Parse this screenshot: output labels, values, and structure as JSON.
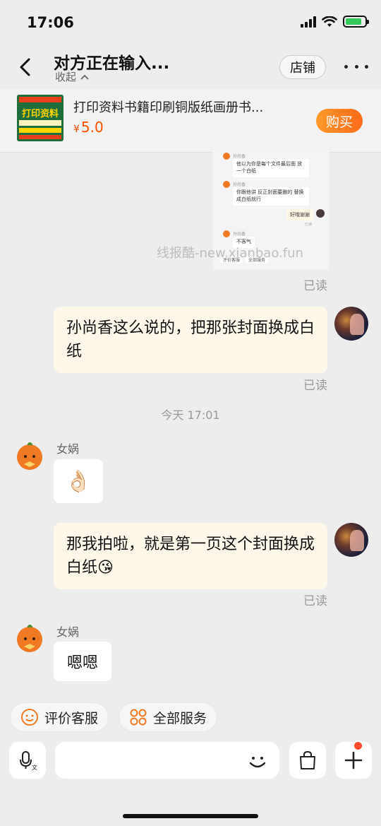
{
  "status_bar": {
    "time": "17:06"
  },
  "nav": {
    "title": "对方正在输入...",
    "collapse_label": "收起",
    "store_label": "店铺"
  },
  "product": {
    "thumb_text": "打印资料",
    "title": "打印资料书籍印刷铜版纸画册书...",
    "price_symbol": "¥",
    "price": "5.0",
    "buy_label": "购买"
  },
  "screenshot_message": {
    "rows": [
      {
        "name": "孙尚香",
        "text": "他以为你是每个文件最后面 放一个白纸"
      },
      {
        "name": "孙尚香",
        "text": "你跟他讲 反正封面要删的 替换成白纸就行"
      },
      {
        "right_text": "好哦谢谢",
        "read": "已读"
      },
      {
        "name": "孙尚香",
        "text": "不客气"
      }
    ],
    "tabs": [
      "评价客服",
      "全部服务"
    ]
  },
  "watermark": "线报酷-new.xianbao.fun",
  "messages": {
    "read_1": "已读",
    "user_msg_1": "孙尚香这么说的，把那张封面换成白纸",
    "read_2": "已读",
    "time_divider": "今天 17:01",
    "seller_name_1": "女娲",
    "seller_emoji_1": "👌🏻",
    "user_msg_2_text": "那我拍啦，就是第一页这个封面换成白纸",
    "user_msg_2_emoji": "😘",
    "read_3": "已读",
    "seller_name_2": "女娲",
    "seller_msg_2": "嗯嗯"
  },
  "quick_actions": {
    "rate_service": "评价客服",
    "all_services": "全部服务"
  },
  "input": {
    "placeholder": ""
  },
  "colors": {
    "accent": "#ff5000",
    "user_bubble": "#fdf8ea",
    "seller_avatar": "#f07a24"
  }
}
